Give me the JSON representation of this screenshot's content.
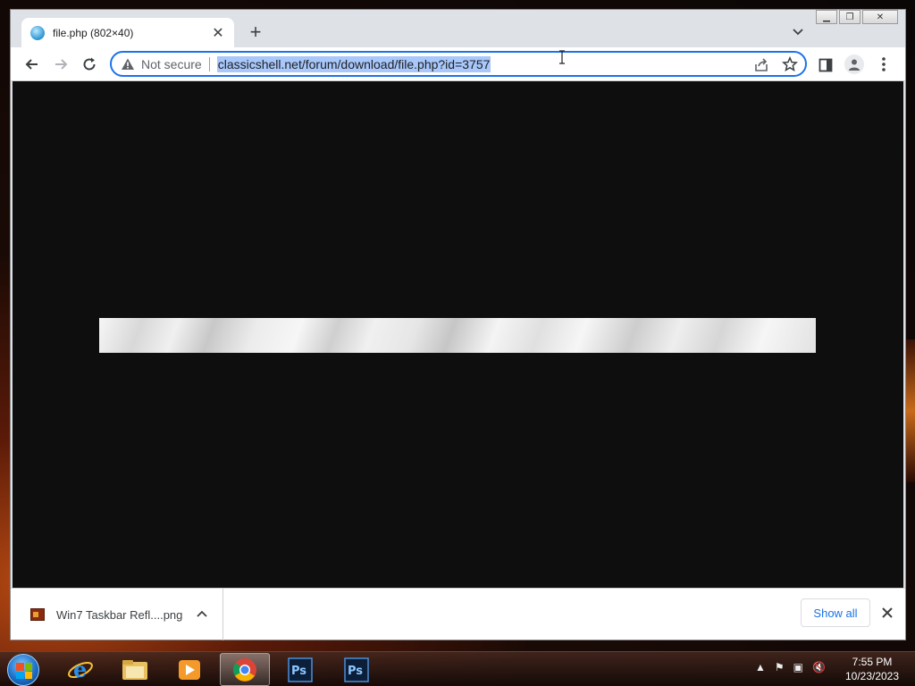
{
  "browser": {
    "tab": {
      "title": "file.php (802×40)",
      "favicon": "globe-icon"
    },
    "new_tab_icon": "plus-icon",
    "window_controls": [
      "minimize",
      "restore",
      "close"
    ]
  },
  "toolbar": {
    "security_label": "Not secure",
    "url": "classicshell.net/forum/download/file.php?id=3757",
    "accent_color": "#1a73e8",
    "selection_color": "#a8c7fa"
  },
  "content": {
    "background": "#0e0e0e"
  },
  "download_shelf": {
    "item_name": "Win7 Taskbar Refl....png",
    "show_all_label": "Show all"
  },
  "taskbar": {
    "apps": [
      "internet-explorer",
      "windows-explorer",
      "media-player",
      "google-chrome",
      "photoshop",
      "photoshop"
    ],
    "active_app": "google-chrome",
    "time": "7:55 PM",
    "date": "10/23/2023"
  }
}
